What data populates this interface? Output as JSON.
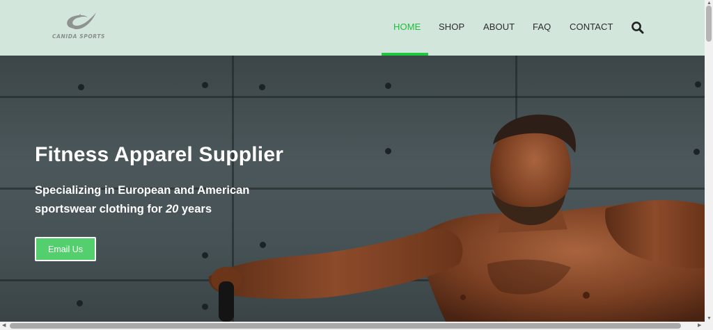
{
  "brand": {
    "logo_text": "CANIDA SPORTS"
  },
  "nav": {
    "items": [
      {
        "label": "HOME",
        "active": true
      },
      {
        "label": "SHOP",
        "active": false
      },
      {
        "label": "ABOUT",
        "active": false
      },
      {
        "label": "FAQ",
        "active": false
      },
      {
        "label": "CONTACT",
        "active": false
      }
    ],
    "search_icon": "search-icon"
  },
  "hero": {
    "title": "Fitness Apparel Supplier",
    "subtitle_line1": "Specializing in European and American",
    "subtitle_line2_prefix": "sportswear clothing for ",
    "subtitle_years": "20",
    "subtitle_line2_suffix": " years",
    "cta_label": "Email Us"
  },
  "colors": {
    "header_bg": "#d3e6dc",
    "accent_green": "#1bbd3c",
    "button_green": "#53cf6d",
    "hero_wall": "#465255"
  }
}
